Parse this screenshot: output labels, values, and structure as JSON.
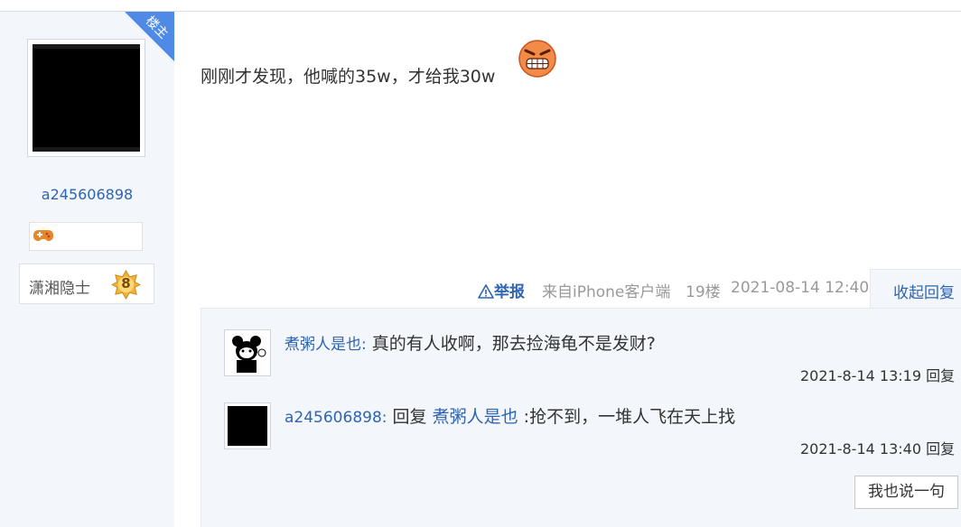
{
  "author": {
    "badge_label": "楼主",
    "username": "a245606898",
    "title": "潇湘隐士",
    "level": "8"
  },
  "post": {
    "content": "刚刚才发现，他喊的35w，才给我30w"
  },
  "meta": {
    "report": "举报",
    "from": "来自iPhone客户端",
    "floor": "19楼",
    "time": "2021-08-14 12:40",
    "collapse": "收起回复"
  },
  "replies": [
    {
      "user": "煮粥人是也",
      "separator": ":",
      "text": "真的有人收啊，那去捡海龟不是发财?",
      "time": "2021-8-14 13:19",
      "reply_label": "回复"
    },
    {
      "user": "a245606898",
      "separator": ":",
      "prefix": "回复",
      "target": "煮粥人是也",
      "text": ":抢不到，一堆人飞在天上找",
      "time": "2021-8-14 13:40",
      "reply_label": "回复"
    }
  ],
  "say_button": "我也说一句",
  "colors": {
    "link": "#2d64b3",
    "panel_bg": "#f3f6fb",
    "ribbon": "#4f8ae6"
  }
}
